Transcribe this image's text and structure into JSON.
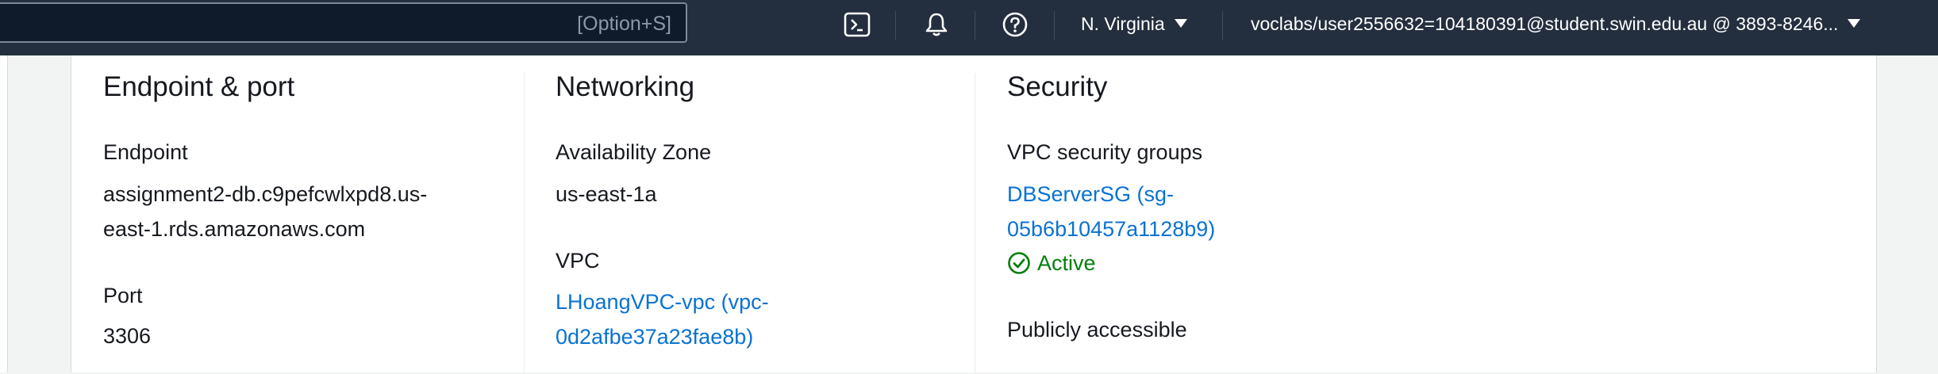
{
  "header": {
    "search_hint": "[Option+S]",
    "region": "N. Virginia",
    "account": "voclabs/user2556632=104180391@student.swin.edu.au @ 3893-8246...",
    "icons": [
      "cloudshell-icon",
      "notifications-bell-icon",
      "help-icon"
    ]
  },
  "sections": {
    "endpoint_port": {
      "title": "Endpoint & port",
      "endpoint_label": "Endpoint",
      "endpoint_line1": "assignment2-db.c9pefcwlxpd8.us-",
      "endpoint_line2": "east-1.rds.amazonaws.com",
      "port_label": "Port",
      "port_value": "3306"
    },
    "networking": {
      "title": "Networking",
      "az_label": "Availability Zone",
      "az_value": "us-east-1a",
      "vpc_label": "VPC",
      "vpc_line1": "LHoangVPC-vpc (vpc-",
      "vpc_line2": "0d2afbe37a23fae8b)"
    },
    "security": {
      "title": "Security",
      "sg_label": "VPC security groups",
      "sg_line1": "DBServerSG (sg-",
      "sg_line2": "05b6b10457a1128b9)",
      "sg_status": "Active",
      "public_label": "Publicly accessible"
    }
  },
  "colors": {
    "nav_bg": "#232f3e",
    "link": "#0972d3",
    "success": "#037f0c"
  }
}
